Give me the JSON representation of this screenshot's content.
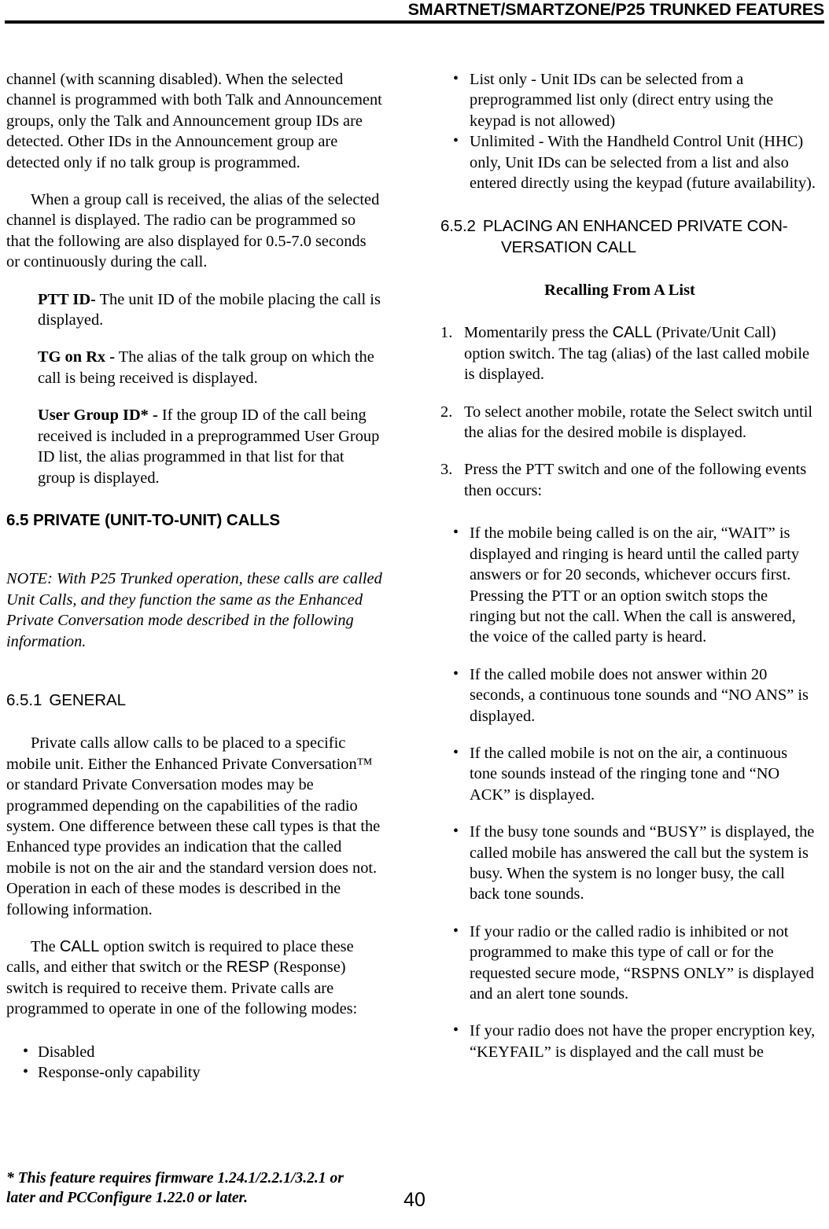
{
  "header": {
    "title": "SMARTNET/SMARTZONE/P25 TRUNKED FEATURES"
  },
  "left_column": {
    "para_continued": "channel (with scanning disabled). When the selected channel is programmed with both Talk and Announcement groups, only the Talk and Announcement group IDs are detected. Other IDs in the Announcement group are detected only if no talk group is programmed.",
    "para_group_call": "When a group call is received, the alias of the selected channel is displayed. The radio can be programmed so that the following are also displayed for 0.5-7.0 seconds or continuously during the call.",
    "definitions": [
      {
        "term": "PTT ID-",
        "text": " The unit ID of the mobile placing the call is displayed."
      },
      {
        "term": "TG on Rx -",
        "text": " The alias of the talk group on which the call is being received is displayed."
      },
      {
        "term": "User Group ID* -",
        "text": " If the group ID of the call being received is included in a preprogrammed User Group ID list, the alias programmed in that list for that group is displayed."
      }
    ],
    "heading_6_5": "6.5 PRIVATE (UNIT-TO-UNIT) CALLS",
    "note": "NOTE: With P25 Trunked operation, these calls are called Unit Calls, and they function the same as the Enhanced Private Conversation mode described in the following information.",
    "heading_6_5_1_num": "6.5.1",
    "heading_6_5_1_text": "GENERAL",
    "para_general": "Private calls allow calls to be placed to a specific mobile unit. Either the Enhanced Private Conversation™ or standard Private Conversation modes may be programmed depending on the capabilities of the radio system. One difference between these call types is that the Enhanced type provides an indication that the called mobile is not on the air and the standard version does not. Operation in each of these modes is described in the following information.",
    "para_switch_a": "The ",
    "switch_call": "CALL",
    "para_switch_b": " option switch is required to place these calls, and either that switch or the ",
    "switch_resp": "RESP",
    "para_switch_c": " (Response) switch is required to receive them. Private calls are programmed to operate in one of the following modes:",
    "mode_bullets": [
      "Disabled",
      "Response-only capability"
    ]
  },
  "right_column": {
    "mode_bullets_continued": [
      "List only - Unit IDs can be selected from a preprogrammed list only (direct entry using the keypad is not allowed)",
      "Unlimited - With the Handheld Control Unit (HHC) only, Unit IDs can be selected from a list and also entered directly using the keypad (future availability)."
    ],
    "heading_6_5_2_num": "6.5.2",
    "heading_6_5_2_line1": "PLACING AN ENHANCED PRIVATE CON-",
    "heading_6_5_2_line2": "VERSATION CALL",
    "subhead_recalling": "Recalling From A List",
    "steps": [
      {
        "num": "1.",
        "text_a": "Momentarily press the ",
        "switch": "CALL",
        "text_b": " (Private/Unit Call) option switch. The tag (alias) of the last called mobile is displayed."
      },
      {
        "num": "2.",
        "text_a": "To select another mobile, rotate the Select switch until the alias for the desired mobile is displayed.",
        "switch": "",
        "text_b": ""
      },
      {
        "num": "3.",
        "text_a": "Press the PTT switch and one of the following events then occurs:",
        "switch": "",
        "text_b": ""
      }
    ],
    "event_bullets": [
      "If the mobile being called is on the air, “WAIT” is displayed and ringing is heard until the called party answers or for 20 seconds, whichever occurs first. Pressing the PTT or an option switch stops the ringing but not the call. When the call is answered, the voice of the called party is heard.",
      "If the called mobile does not answer within 20 seconds, a continuous tone sounds and “NO ANS” is displayed.",
      "If the called mobile is not on the air, a continuous tone sounds instead of the ringing tone and “NO ACK” is displayed.",
      "If the busy tone sounds and “BUSY” is displayed, the called mobile has answered the call but the system is busy. When the system is no longer busy, the call back tone sounds.",
      "If your radio or the called radio is inhibited or not programmed to make this type of call or for the requested secure mode, “RSPNS ONLY” is displayed and an alert tone sounds.",
      "If your radio does not have the proper encryption key, “KEYFAIL” is displayed and the call must be"
    ]
  },
  "footer": {
    "footnote": "* This feature requires firmware 1.24.1/2.2.1/3.2.1 or later and PCConfigure 1.22.0 or later.",
    "page_number": "40"
  },
  "bullet_glyph": "•"
}
